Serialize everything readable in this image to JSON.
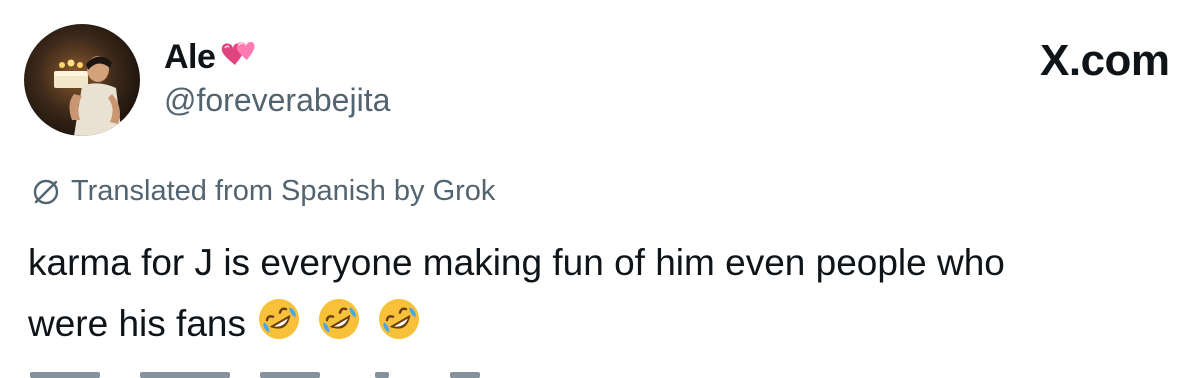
{
  "author": {
    "display_name": "Ale",
    "name_emoji": "revolving-hearts-icon",
    "handle": "@foreverabejita"
  },
  "brand": {
    "text": "X.com"
  },
  "translation": {
    "label": "Translated from Spanish by Grok",
    "icon": "translate-globe-icon"
  },
  "tweet": {
    "line1": "karma for J is everyone making fun of him even people who",
    "line2": "were his fans",
    "emojis": [
      "rolling-on-floor-laughing-icon",
      "rolling-on-floor-laughing-icon",
      "rolling-on-floor-laughing-icon"
    ]
  },
  "colors": {
    "text_primary": "#0f1419",
    "text_secondary": "#536471",
    "emoji_yellow": "#f7c23a",
    "heart_pink": "#e0447f"
  }
}
